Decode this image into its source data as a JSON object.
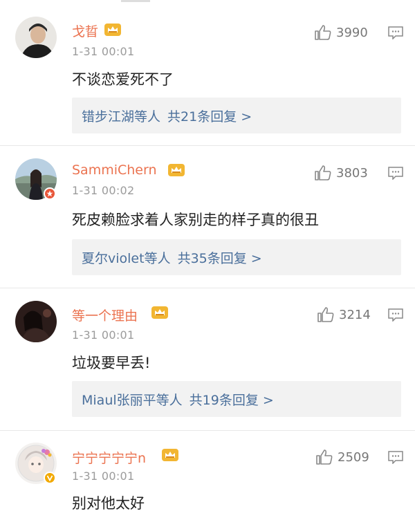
{
  "comments": [
    {
      "username": "戈晢",
      "time": "1-31 00:01",
      "text": "不谈恋爱死不了",
      "likes": "3990",
      "replies_users": "错步江湖等人",
      "replies_count": "共21条回复 >"
    },
    {
      "username": "SammiChern",
      "time": "1-31 00:02",
      "text": "死皮赖脸求着人家别走的样子真的很丑",
      "likes": "3803",
      "replies_users": "夏尔violet等人",
      "replies_count": "共35条回复 >"
    },
    {
      "username": "等一个理由",
      "time": "1-31 00:01",
      "text": "垃圾要早丢!",
      "likes": "3214",
      "replies_users": "Miaul张丽平等人",
      "replies_count": "共19条回复 >"
    },
    {
      "username": "宁宁宁宁宁n",
      "time": "1-31 00:01",
      "text": "别对他太好",
      "likes": "2509"
    }
  ],
  "colors": {
    "username": "#eb7350",
    "reply_link": "#4a6f9b",
    "reply_bg": "#f2f2f2",
    "time": "#9b9b9b",
    "crown_gold": "#f2b632"
  }
}
